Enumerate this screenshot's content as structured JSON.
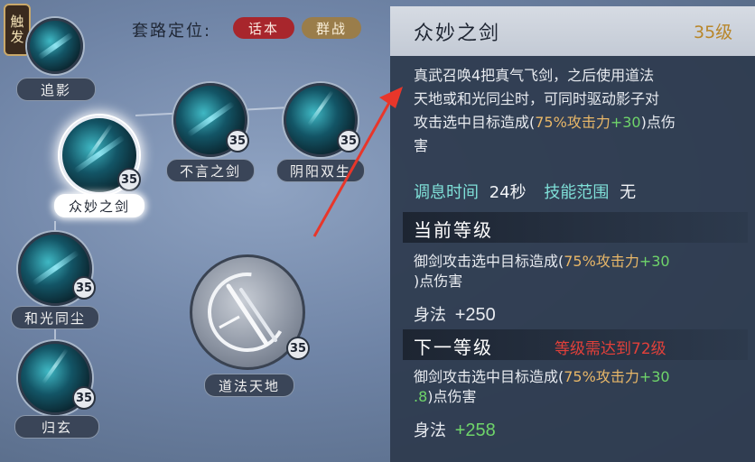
{
  "left": {
    "trigger_badge": "触发",
    "route_label": "套路定位:",
    "tags": [
      {
        "label": "话本",
        "color": "#a8262c"
      },
      {
        "label": "群战",
        "color": "#9a7d4a"
      }
    ],
    "skills": [
      {
        "id": "zhuiying",
        "name": "追影",
        "level": ""
      },
      {
        "id": "zhongmiao",
        "name": "众妙之剑",
        "level": "35"
      },
      {
        "id": "buyan",
        "name": "不言之剑",
        "level": "35"
      },
      {
        "id": "yinyang",
        "name": "阴阳双生",
        "level": "35"
      },
      {
        "id": "heguang",
        "name": "和光同尘",
        "level": "35"
      },
      {
        "id": "guixuan",
        "name": "归玄",
        "level": "35"
      },
      {
        "id": "daofa",
        "name": "道法天地",
        "level": "35"
      }
    ]
  },
  "panel": {
    "title": "众妙之剑",
    "level": "35级",
    "desc": {
      "lines": [
        "真武召唤4把真气飞剑，之后使用道法",
        "天地或和光同尘时，可同时驱动影子对"
      ],
      "line3_pre": "攻击选中目标造成(",
      "line3_pct": "75%攻击力",
      "line3_plus": "+30",
      "line3_post": ")点伤",
      "line4": "害"
    },
    "cooldown_label": "调息时间",
    "cooldown_value": "24秒",
    "range_label": "技能范围",
    "range_value": "无",
    "current": {
      "header": "当前等级",
      "line1_pre": "御剑攻击选中目标造成(",
      "line1_pct": "75%攻击力",
      "line1_plus": "+30",
      "line2": ")点伤害",
      "stat_label": "身法",
      "stat_value": "+250"
    },
    "next": {
      "header": "下一等级",
      "requirement": "等级需达到72级",
      "line1_pre": "御剑攻击选中目标造成(",
      "line1_pct": "75%攻击力",
      "line1_plus": "+30",
      "line2_plus": ".8",
      "line2_post": ")点伤害",
      "stat_label": "身法",
      "stat_value": "+258"
    }
  },
  "colors": {
    "gold": "#e8b768",
    "green": "#6fd46a",
    "red": "#e2403a",
    "cyan": "#7fe0d8"
  },
  "annotation": {
    "arrow_color": "#e8362a",
    "arrow_icon": "red-arrow-icon"
  }
}
